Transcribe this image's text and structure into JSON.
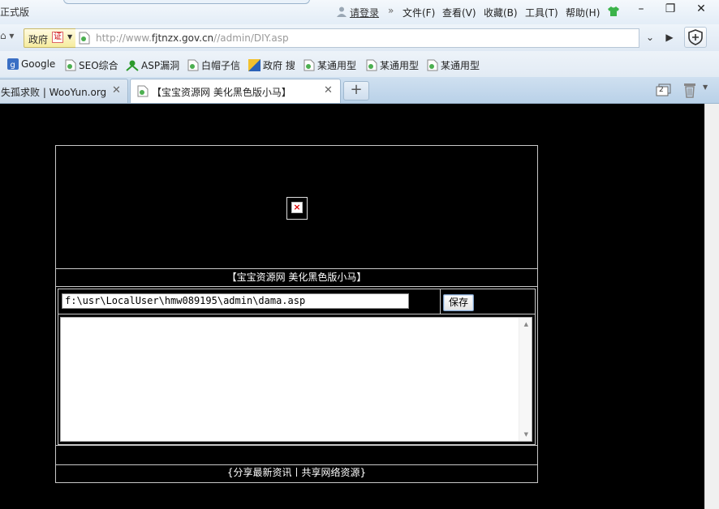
{
  "window": {
    "title": "正式版",
    "login": "请登录",
    "menu": [
      "文件(F)",
      "查看(V)",
      "收藏(B)",
      "工具(T)",
      "帮助(H)"
    ]
  },
  "addressbar": {
    "gov_label": "政府",
    "cert_label": "证",
    "url_prefix": "http://www.",
    "url_domain": "fjtnzx.gov.cn",
    "url_path": "//admin/DIY.asp"
  },
  "bookmarks": [
    {
      "label": "Google",
      "icon": "google-icon"
    },
    {
      "label": "SEO综合",
      "icon": "page-icon"
    },
    {
      "label": "ASP漏洞",
      "icon": "bug-icon"
    },
    {
      "label": "白帽子信",
      "icon": "page-icon"
    },
    {
      "label": "政府 搜",
      "icon": "search-site-icon"
    },
    {
      "label": "某通用型",
      "icon": "page-icon"
    },
    {
      "label": "某通用型",
      "icon": "page-icon"
    },
    {
      "label": "某通用型",
      "icon": "page-icon"
    }
  ],
  "tabs": [
    {
      "label": "失孤求败 | WooYun.org",
      "active": false
    },
    {
      "label": "【宝宝资源网 美化黑色版小马】",
      "active": true
    }
  ],
  "tab_count": "2",
  "page": {
    "title": "【宝宝资源网 美化黑色版小马】",
    "path_value": "f:\\usr\\LocalUser\\hmw089195\\admin\\dama.asp",
    "save_label": "保存",
    "textarea_value": "",
    "footer": "{分享最新资讯丨共享网络资源}"
  },
  "colors": {
    "page_bg": "#000000",
    "border": "#c8c8c8",
    "chrome_bg": "#e3edf7"
  }
}
